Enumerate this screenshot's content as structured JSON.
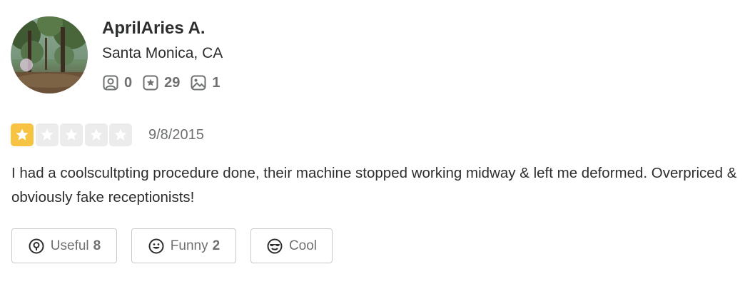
{
  "user": {
    "name": "AprilAries A.",
    "location": "Santa Monica, CA",
    "stats": {
      "friends": "0",
      "reviews": "29",
      "photos": "1"
    }
  },
  "review": {
    "rating": 1,
    "rating_max": 5,
    "date": "9/8/2015",
    "text": "I had a coolscultpting procedure done, their machine stopped working midway & left me deformed. Overpriced & obviously fake receptionists!"
  },
  "reactions": {
    "useful_label": "Useful",
    "useful_count": "8",
    "funny_label": "Funny",
    "funny_count": "2",
    "cool_label": "Cool"
  },
  "colors": {
    "star_active": "#f6c343",
    "star_inactive": "#ececec",
    "text_primary": "#2d2e2f",
    "text_secondary": "#6e7072",
    "button_border": "#c8c9ca"
  },
  "icons": {
    "friends": "friends-icon",
    "reviews": "review-star-icon",
    "photos": "photo-icon",
    "useful": "lightbulb-icon",
    "funny": "smile-icon",
    "cool": "sunglasses-icon"
  }
}
